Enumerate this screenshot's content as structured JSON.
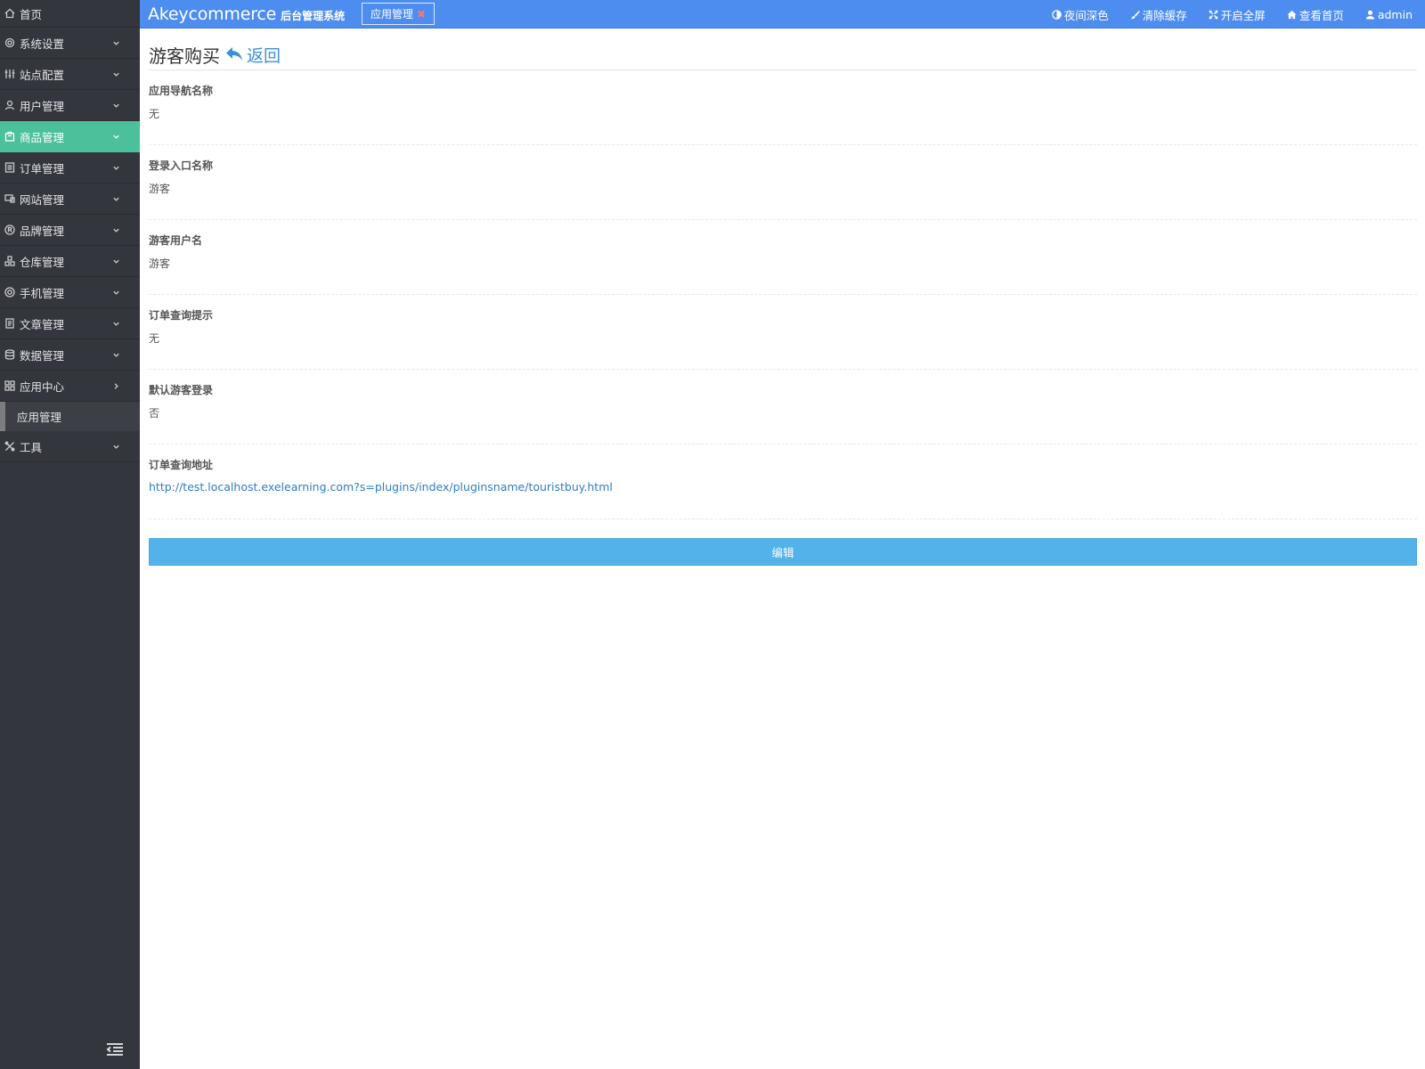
{
  "sidebar": {
    "home": "首页",
    "items": [
      {
        "label": "系统设置",
        "icon": "gear-icon"
      },
      {
        "label": "站点配置",
        "icon": "sliders-icon"
      },
      {
        "label": "用户管理",
        "icon": "user-icon"
      },
      {
        "label": "商品管理",
        "icon": "bag-icon",
        "active": true
      },
      {
        "label": "订单管理",
        "icon": "list-icon"
      },
      {
        "label": "网站管理",
        "icon": "monitor-icon"
      },
      {
        "label": "品牌管理",
        "icon": "registered-icon"
      },
      {
        "label": "仓库管理",
        "icon": "boxes-icon"
      },
      {
        "label": "手机管理",
        "icon": "phone-icon"
      },
      {
        "label": "文章管理",
        "icon": "document-icon"
      },
      {
        "label": "数据管理",
        "icon": "database-icon"
      },
      {
        "label": "应用中心",
        "icon": "grid-icon",
        "expanded": true
      }
    ],
    "sub_item": "应用管理",
    "tools": "工具"
  },
  "topbar": {
    "brand_name": "Akeycommerce",
    "brand_sub": "后台管理系统",
    "tab_label": "应用管理",
    "nav": {
      "night": "夜间深色",
      "clear_cache": "清除缓存",
      "fullscreen": "开启全屏",
      "view_home": "查看首页",
      "user": "admin"
    }
  },
  "page": {
    "title": "游客购买",
    "back": "返回",
    "fields": [
      {
        "label": "应用导航名称",
        "value": "无"
      },
      {
        "label": "登录入口名称",
        "value": "游客"
      },
      {
        "label": "游客用户名",
        "value": "游客"
      },
      {
        "label": "订单查询提示",
        "value": "无"
      },
      {
        "label": "默认游客登录",
        "value": "否"
      },
      {
        "label": "订单查询地址",
        "value": "http://test.localhost.exelearning.com?s=plugins/index/pluginsname/touristbuy.html"
      }
    ],
    "edit_button": "编辑"
  },
  "colors": {
    "topbar": "#4d8df0",
    "sidebar": "#33363c",
    "active_item": "#4cbf9b",
    "button": "#53b2ea",
    "link": "#2f7dc2"
  }
}
